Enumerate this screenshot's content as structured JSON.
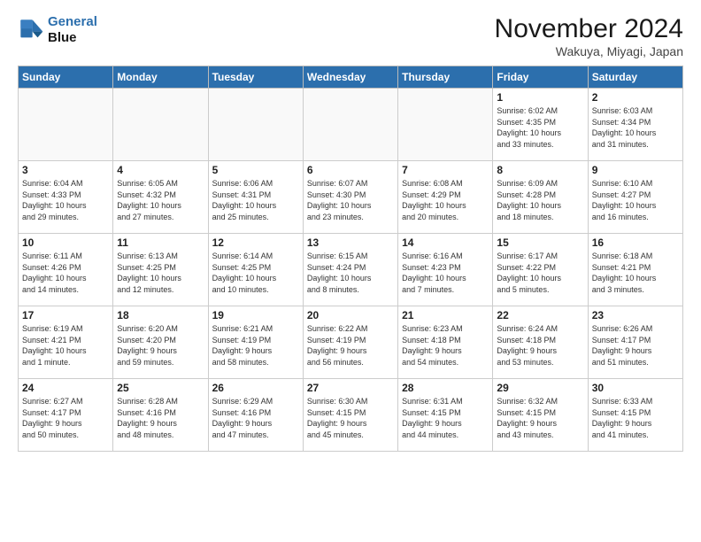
{
  "header": {
    "logo_line1": "General",
    "logo_line2": "Blue",
    "month": "November 2024",
    "location": "Wakuya, Miyagi, Japan"
  },
  "weekdays": [
    "Sunday",
    "Monday",
    "Tuesday",
    "Wednesday",
    "Thursday",
    "Friday",
    "Saturday"
  ],
  "weeks": [
    [
      {
        "day": "",
        "info": ""
      },
      {
        "day": "",
        "info": ""
      },
      {
        "day": "",
        "info": ""
      },
      {
        "day": "",
        "info": ""
      },
      {
        "day": "",
        "info": ""
      },
      {
        "day": "1",
        "info": "Sunrise: 6:02 AM\nSunset: 4:35 PM\nDaylight: 10 hours\nand 33 minutes."
      },
      {
        "day": "2",
        "info": "Sunrise: 6:03 AM\nSunset: 4:34 PM\nDaylight: 10 hours\nand 31 minutes."
      }
    ],
    [
      {
        "day": "3",
        "info": "Sunrise: 6:04 AM\nSunset: 4:33 PM\nDaylight: 10 hours\nand 29 minutes."
      },
      {
        "day": "4",
        "info": "Sunrise: 6:05 AM\nSunset: 4:32 PM\nDaylight: 10 hours\nand 27 minutes."
      },
      {
        "day": "5",
        "info": "Sunrise: 6:06 AM\nSunset: 4:31 PM\nDaylight: 10 hours\nand 25 minutes."
      },
      {
        "day": "6",
        "info": "Sunrise: 6:07 AM\nSunset: 4:30 PM\nDaylight: 10 hours\nand 23 minutes."
      },
      {
        "day": "7",
        "info": "Sunrise: 6:08 AM\nSunset: 4:29 PM\nDaylight: 10 hours\nand 20 minutes."
      },
      {
        "day": "8",
        "info": "Sunrise: 6:09 AM\nSunset: 4:28 PM\nDaylight: 10 hours\nand 18 minutes."
      },
      {
        "day": "9",
        "info": "Sunrise: 6:10 AM\nSunset: 4:27 PM\nDaylight: 10 hours\nand 16 minutes."
      }
    ],
    [
      {
        "day": "10",
        "info": "Sunrise: 6:11 AM\nSunset: 4:26 PM\nDaylight: 10 hours\nand 14 minutes."
      },
      {
        "day": "11",
        "info": "Sunrise: 6:13 AM\nSunset: 4:25 PM\nDaylight: 10 hours\nand 12 minutes."
      },
      {
        "day": "12",
        "info": "Sunrise: 6:14 AM\nSunset: 4:25 PM\nDaylight: 10 hours\nand 10 minutes."
      },
      {
        "day": "13",
        "info": "Sunrise: 6:15 AM\nSunset: 4:24 PM\nDaylight: 10 hours\nand 8 minutes."
      },
      {
        "day": "14",
        "info": "Sunrise: 6:16 AM\nSunset: 4:23 PM\nDaylight: 10 hours\nand 7 minutes."
      },
      {
        "day": "15",
        "info": "Sunrise: 6:17 AM\nSunset: 4:22 PM\nDaylight: 10 hours\nand 5 minutes."
      },
      {
        "day": "16",
        "info": "Sunrise: 6:18 AM\nSunset: 4:21 PM\nDaylight: 10 hours\nand 3 minutes."
      }
    ],
    [
      {
        "day": "17",
        "info": "Sunrise: 6:19 AM\nSunset: 4:21 PM\nDaylight: 10 hours\nand 1 minute."
      },
      {
        "day": "18",
        "info": "Sunrise: 6:20 AM\nSunset: 4:20 PM\nDaylight: 9 hours\nand 59 minutes."
      },
      {
        "day": "19",
        "info": "Sunrise: 6:21 AM\nSunset: 4:19 PM\nDaylight: 9 hours\nand 58 minutes."
      },
      {
        "day": "20",
        "info": "Sunrise: 6:22 AM\nSunset: 4:19 PM\nDaylight: 9 hours\nand 56 minutes."
      },
      {
        "day": "21",
        "info": "Sunrise: 6:23 AM\nSunset: 4:18 PM\nDaylight: 9 hours\nand 54 minutes."
      },
      {
        "day": "22",
        "info": "Sunrise: 6:24 AM\nSunset: 4:18 PM\nDaylight: 9 hours\nand 53 minutes."
      },
      {
        "day": "23",
        "info": "Sunrise: 6:26 AM\nSunset: 4:17 PM\nDaylight: 9 hours\nand 51 minutes."
      }
    ],
    [
      {
        "day": "24",
        "info": "Sunrise: 6:27 AM\nSunset: 4:17 PM\nDaylight: 9 hours\nand 50 minutes."
      },
      {
        "day": "25",
        "info": "Sunrise: 6:28 AM\nSunset: 4:16 PM\nDaylight: 9 hours\nand 48 minutes."
      },
      {
        "day": "26",
        "info": "Sunrise: 6:29 AM\nSunset: 4:16 PM\nDaylight: 9 hours\nand 47 minutes."
      },
      {
        "day": "27",
        "info": "Sunrise: 6:30 AM\nSunset: 4:15 PM\nDaylight: 9 hours\nand 45 minutes."
      },
      {
        "day": "28",
        "info": "Sunrise: 6:31 AM\nSunset: 4:15 PM\nDaylight: 9 hours\nand 44 minutes."
      },
      {
        "day": "29",
        "info": "Sunrise: 6:32 AM\nSunset: 4:15 PM\nDaylight: 9 hours\nand 43 minutes."
      },
      {
        "day": "30",
        "info": "Sunrise: 6:33 AM\nSunset: 4:15 PM\nDaylight: 9 hours\nand 41 minutes."
      }
    ]
  ]
}
